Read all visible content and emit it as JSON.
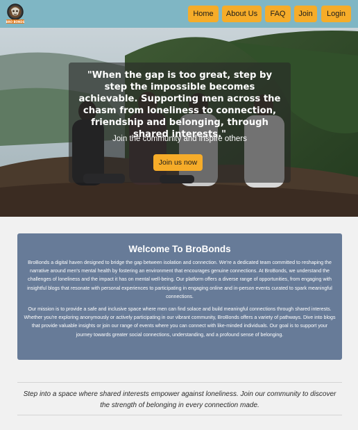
{
  "nav": {
    "logo_text": "BRO BONDS",
    "items": [
      {
        "label": "Home"
      },
      {
        "label": "About Us"
      },
      {
        "label": "FAQ"
      },
      {
        "label": "Join"
      },
      {
        "label": "Login"
      }
    ]
  },
  "hero": {
    "quote": "\"When the gap is too great, step by step the impossible becomes achievable. Supporting men across the chasm from loneliness to connection, friendship and belonging, through shared interests.\"",
    "subtitle": "Join the community and inspire others",
    "cta_label": "Join us now"
  },
  "welcome": {
    "title": "Welcome To BroBonds",
    "paragraph1": "BroBonds a digital haven designed to bridge the gap between isolation and connection. We're a dedicated team committed to reshaping the narrative around men's mental health by fostering an environment that encourages genuine connections. At BroBonds, we understand the challenges of loneliness and the impact it has on mental well-being. Our platform offers a diverse range of opportunities, from engaging with insightful blogs that resonate with personal experiences to participating in engaging online and in-person events curated to spark meaningful connections.",
    "paragraph2": "Our mission is to provide a safe and inclusive space where men can find solace and build meaningful connections through shared interests. Whether you're exploring anonymously or actively participating in our vibrant community, BroBonds offers a variety of pathways. Dive into blogs that provide valuable insights or join our range of events where you can connect with like-minded individuals. Our goal is to support your journey towards greater social connections, understanding, and a profound sense of belonging."
  },
  "tagline": "Step into a space where shared interests empower against loneliness. Join our community to discover the strength of belonging in every connection made.",
  "colors": {
    "nav_bg": "#7fb6c4",
    "accent": "#f6ac29",
    "welcome_bg": "#677b98",
    "page_bg": "#f1f1f1"
  }
}
